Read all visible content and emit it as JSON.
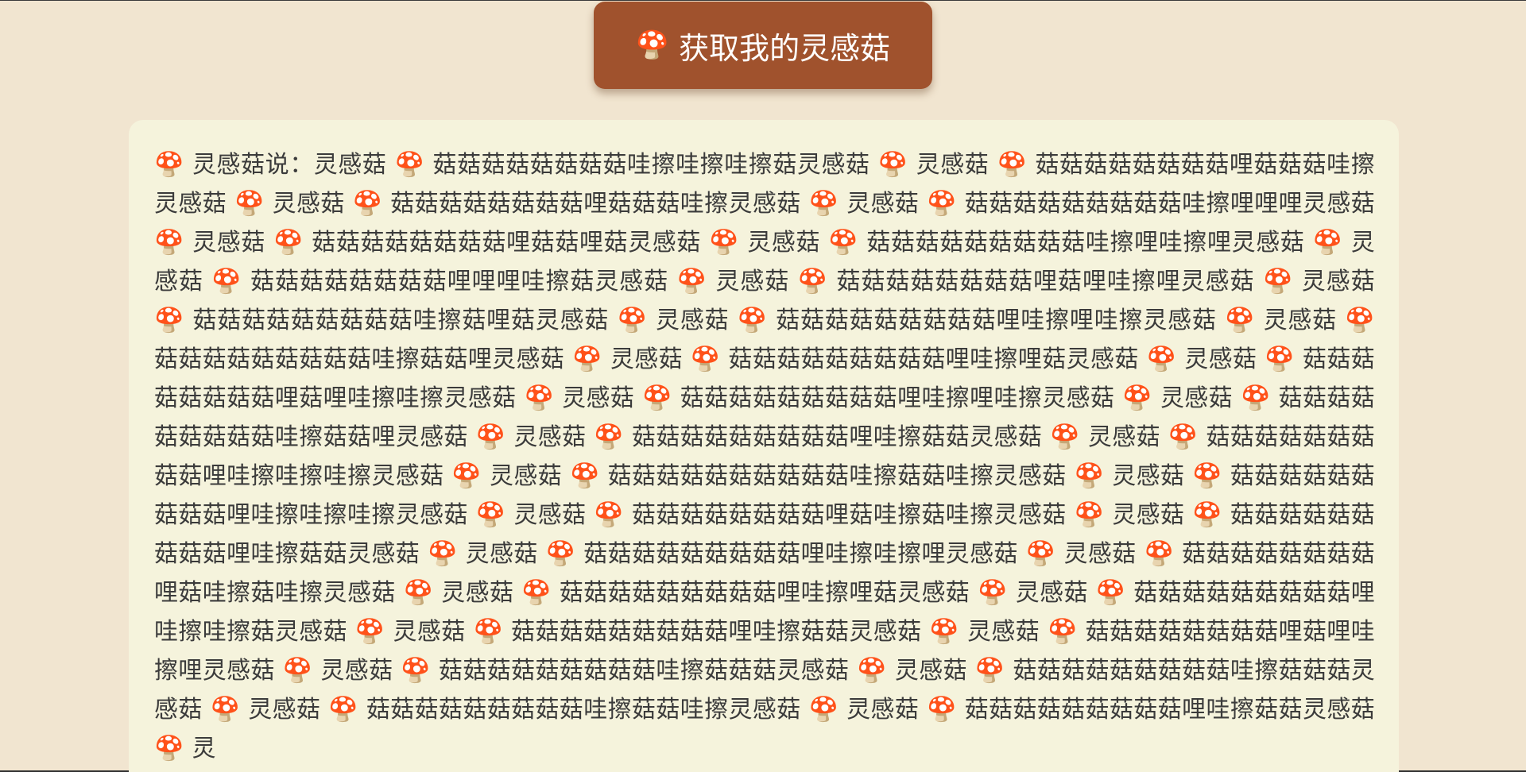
{
  "button": {
    "icon": "🍄",
    "label": "获取我的灵感菇"
  },
  "output": {
    "text": "🍄 灵感菇说：灵感菇 🍄 菇菇菇菇菇菇菇菇哇擦哇擦哇擦菇灵感菇 🍄 灵感菇 🍄 菇菇菇菇菇菇菇菇哩菇菇菇哇擦灵感菇 🍄 灵感菇 🍄 菇菇菇菇菇菇菇菇哩菇菇菇哇擦灵感菇 🍄 灵感菇 🍄 菇菇菇菇菇菇菇菇菇哇擦哩哩哩灵感菇 🍄 灵感菇 🍄 菇菇菇菇菇菇菇菇哩菇菇哩菇灵感菇 🍄 灵感菇 🍄 菇菇菇菇菇菇菇菇菇哇擦哩哇擦哩灵感菇 🍄 灵感菇 🍄 菇菇菇菇菇菇菇菇哩哩哩哇擦菇灵感菇 🍄 灵感菇 🍄 菇菇菇菇菇菇菇菇哩菇哩哇擦哩灵感菇 🍄 灵感菇 🍄 菇菇菇菇菇菇菇菇菇哇擦菇哩菇灵感菇 🍄 灵感菇 🍄 菇菇菇菇菇菇菇菇菇哩哇擦哩哇擦灵感菇 🍄 灵感菇 🍄 菇菇菇菇菇菇菇菇菇哇擦菇菇哩灵感菇 🍄 灵感菇 🍄 菇菇菇菇菇菇菇菇菇哩哇擦哩菇灵感菇 🍄 灵感菇 🍄 菇菇菇菇菇菇菇菇哩菇哩哇擦哇擦灵感菇 🍄 灵感菇 🍄 菇菇菇菇菇菇菇菇菇哩哇擦哩哇擦灵感菇 🍄 灵感菇 🍄 菇菇菇菇菇菇菇菇菇哇擦菇菇哩灵感菇 🍄 灵感菇 🍄 菇菇菇菇菇菇菇菇菇哩哇擦菇菇灵感菇 🍄 灵感菇 🍄 菇菇菇菇菇菇菇菇菇哩哇擦哇擦哇擦灵感菇 🍄 灵感菇 🍄 菇菇菇菇菇菇菇菇菇菇哇擦菇菇哇擦灵感菇 🍄 灵感菇 🍄 菇菇菇菇菇菇菇菇菇哩哇擦哇擦哇擦灵感菇 🍄 灵感菇 🍄 菇菇菇菇菇菇菇菇哩菇哇擦菇哇擦灵感菇 🍄 灵感菇 🍄 菇菇菇菇菇菇菇菇菇哩哇擦菇菇灵感菇 🍄 灵感菇 🍄 菇菇菇菇菇菇菇菇菇哩哇擦哇擦哩灵感菇 🍄 灵感菇 🍄 菇菇菇菇菇菇菇菇哩菇哇擦菇哇擦灵感菇 🍄 灵感菇 🍄 菇菇菇菇菇菇菇菇菇哩哇擦哩菇灵感菇 🍄 灵感菇 🍄 菇菇菇菇菇菇菇菇菇哩哇擦哇擦菇灵感菇 🍄 灵感菇 🍄 菇菇菇菇菇菇菇菇菇哩哇擦菇菇灵感菇 🍄 灵感菇 🍄 菇菇菇菇菇菇菇菇哩菇哩哇擦哩灵感菇 🍄 灵感菇 🍄 菇菇菇菇菇菇菇菇菇哇擦菇菇菇灵感菇 🍄 灵感菇 🍄 菇菇菇菇菇菇菇菇菇哇擦菇菇菇灵感菇 🍄 灵感菇 🍄 菇菇菇菇菇菇菇菇菇哇擦菇菇哇擦灵感菇 🍄 灵感菇 🍄 菇菇菇菇菇菇菇菇菇哩哇擦菇菇灵感菇 🍄 灵"
  }
}
